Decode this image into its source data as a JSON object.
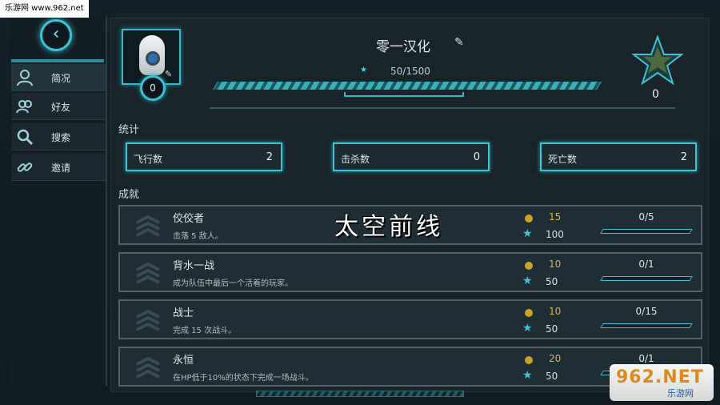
{
  "watermark": "乐游网 www.962.net",
  "nav": [
    {
      "label": "简况",
      "icon": "user-icon"
    },
    {
      "label": "好友",
      "icon": "friends-icon"
    },
    {
      "label": "搜索",
      "icon": "search-icon"
    },
    {
      "label": "邀请",
      "icon": "link-icon"
    }
  ],
  "profile": {
    "name": "零一汉化",
    "level": "0",
    "xp_text": "50/1500",
    "xp_progress": 0.033,
    "rank_value": "0"
  },
  "stats": {
    "title": "统计",
    "items": [
      {
        "label": "飞行数",
        "value": "2"
      },
      {
        "label": "击杀数",
        "value": "0"
      },
      {
        "label": "死亡数",
        "value": "2"
      }
    ]
  },
  "achievements": {
    "title": "成就",
    "items": [
      {
        "name": "佼佼者",
        "desc": "击落 5 敌人。",
        "coins": "15",
        "xp": "100",
        "progress": "0/5",
        "fraction": 0
      },
      {
        "name": "背水一战",
        "desc": "成为队伍中最后一个活着的玩家。",
        "coins": "10",
        "xp": "50",
        "progress": "0/1",
        "fraction": 0
      },
      {
        "name": "战士",
        "desc": "完成 15 次战斗。",
        "coins": "10",
        "xp": "50",
        "progress": "0/15",
        "fraction": 0
      },
      {
        "name": "永恒",
        "desc": "在HP低于10%的状态下完成一场战斗。",
        "coins": "20",
        "xp": "50",
        "progress": "0/1",
        "fraction": 0
      }
    ]
  },
  "overlay_title": "太空前线",
  "logo": {
    "main": "962.NET",
    "sub": "乐游网"
  },
  "colors": {
    "accent": "#3cc3d4",
    "coin": "#c9a227"
  }
}
